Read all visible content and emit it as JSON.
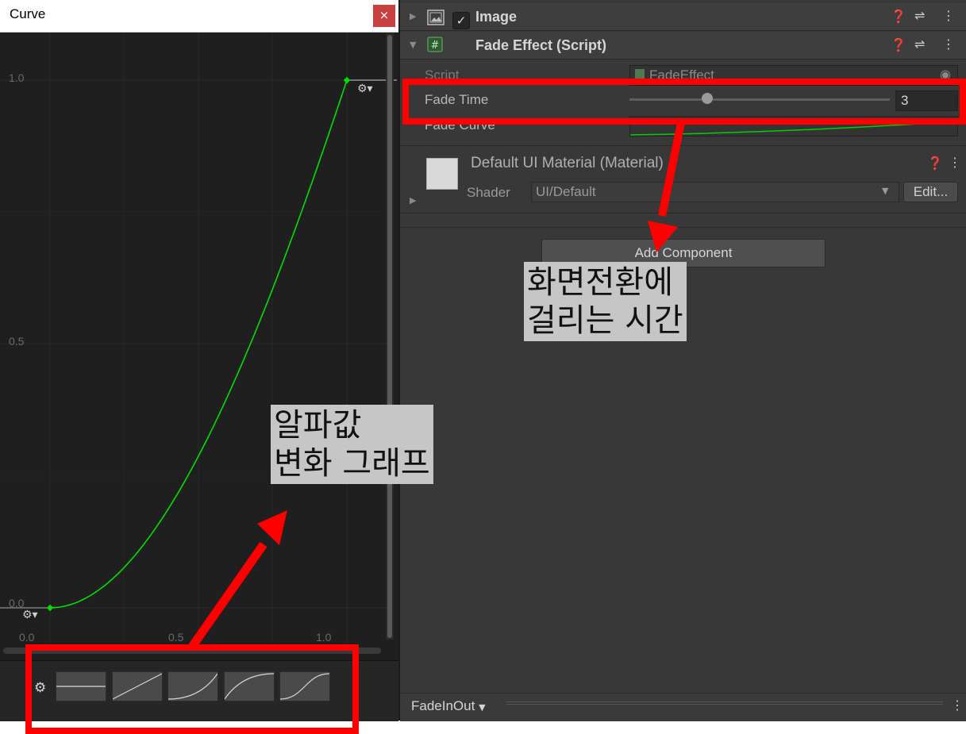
{
  "curve_window": {
    "title": "Curve",
    "close_glyph": "×",
    "y_labels": [
      "1.0",
      "0.5",
      "0.0"
    ],
    "x_labels": [
      "0.0",
      "0.5",
      "1.0"
    ],
    "curve_color": "#00e000",
    "presets": [
      "flat",
      "linear",
      "ease-in",
      "ease-out",
      "ease-in-out"
    ]
  },
  "inspector": {
    "image_component": {
      "title": "Image",
      "enabled": true
    },
    "fade_effect": {
      "title": "Fade Effect (Script)",
      "script_label": "Script",
      "script_value": "FadeEffect",
      "fade_time_label": "Fade Time",
      "fade_time_value": "3",
      "fade_time_slider_fraction": 0.3,
      "fade_curve_label": "Fade Curve"
    },
    "material": {
      "title": "Default UI Material (Material)",
      "shader_label": "Shader",
      "shader_value": "UI/Default",
      "edit_label": "Edit..."
    },
    "add_component_label": "Add Component",
    "bottom_bar_label": "FadeInOut"
  },
  "annotations": {
    "graph_note": {
      "line1": "알파값",
      "line2": "변화 그래프"
    },
    "time_note": {
      "line1": "화면전환에",
      "line2": "걸리는 시간"
    },
    "box_color": "#ff0000"
  }
}
